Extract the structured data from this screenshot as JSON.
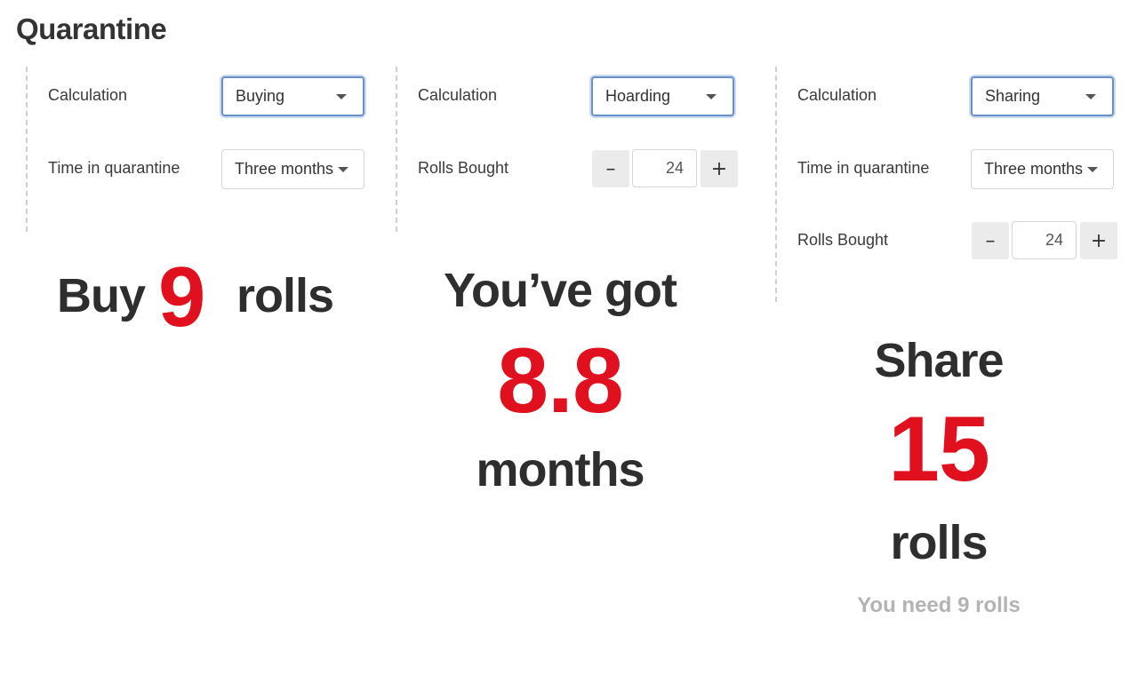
{
  "page_title": "Quarantine",
  "colors": {
    "accent": "#e0101f",
    "text": "#333333",
    "muted": "#b3b3b3",
    "focus": "#6a8fc7"
  },
  "buying": {
    "calculation_label": "Calculation",
    "calculation_value": "Buying",
    "time_label": "Time in quarantine",
    "time_value": "Three months",
    "result_prefix": "Buy",
    "result_number": "9",
    "result_suffix": "rolls"
  },
  "hoarding": {
    "calculation_label": "Calculation",
    "calculation_value": "Hoarding",
    "rolls_label": "Rolls Bought",
    "rolls_value": "24",
    "minus": "–",
    "plus": "+",
    "result_prefix": "You’ve got",
    "result_number": "8.8",
    "result_suffix": "months"
  },
  "sharing": {
    "calculation_label": "Calculation",
    "calculation_value": "Sharing",
    "time_label": "Time in quarantine",
    "time_value": "Three months",
    "rolls_label": "Rolls Bought",
    "rolls_value": "24",
    "minus": "–",
    "plus": "+",
    "result_prefix": "Share",
    "result_number": "15",
    "result_suffix": "rolls",
    "result_note": "You need 9 rolls"
  }
}
